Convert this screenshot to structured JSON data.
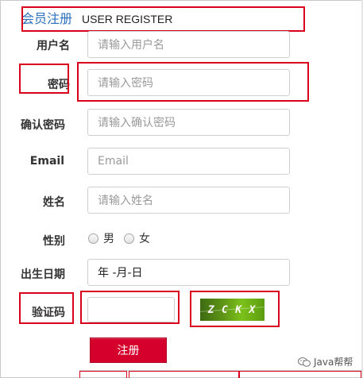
{
  "header": {
    "title_cn": "会员注册",
    "title_en": "USER REGISTER"
  },
  "form": {
    "username": {
      "label": "用户名",
      "placeholder": "请输入用户名"
    },
    "password": {
      "label": "密码",
      "placeholder": "请输入密码"
    },
    "confirm_password": {
      "label": "确认密码",
      "placeholder": "请输入确认密码"
    },
    "email": {
      "label": "Email",
      "placeholder": "Email"
    },
    "name": {
      "label": "姓名",
      "placeholder": "请输入姓名"
    },
    "gender": {
      "label": "性别",
      "options": [
        "男",
        "女"
      ]
    },
    "birthdate": {
      "label": "出生日期",
      "value": "年 -月-日"
    },
    "captcha": {
      "label": "验证码",
      "value": "",
      "image_text": [
        "Z",
        "C",
        "K",
        "X"
      ]
    },
    "submit_label": "注册"
  },
  "watermark": {
    "text": "Java帮帮"
  },
  "colors": {
    "accent": "#d6002d",
    "annotation": "#d9001b",
    "title_blue": "#2a6fbd",
    "captcha_green": "#5e9416"
  }
}
